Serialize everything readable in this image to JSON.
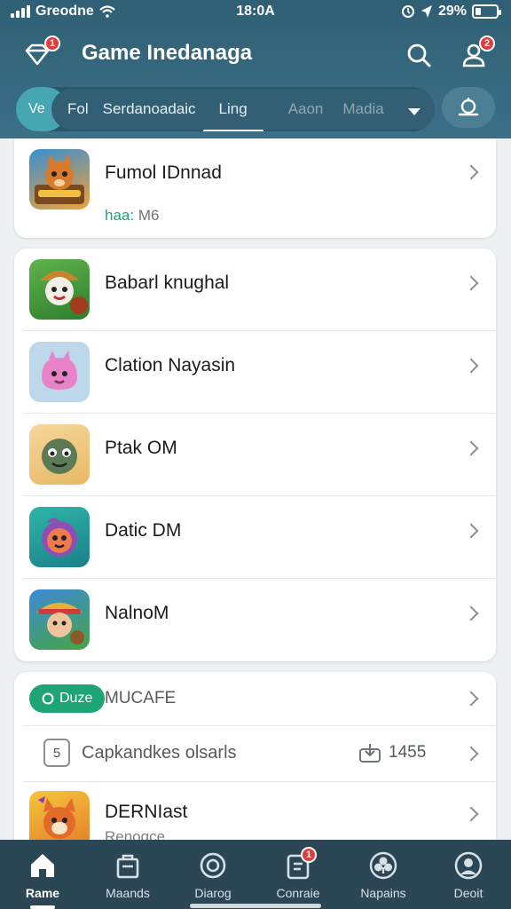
{
  "status_bar": {
    "carrier": "Greodne",
    "time": "18:0A",
    "battery": "29%",
    "battery_level": 0.29
  },
  "header": {
    "title": "Game Inedanaga",
    "menu_badge": "1",
    "profile_badge": "2"
  },
  "tabs": {
    "pill_label": "Ve",
    "items": [
      {
        "label": "Fol",
        "state": "normal"
      },
      {
        "label": "Serdanoadaic",
        "state": "normal"
      },
      {
        "label": "Ling",
        "state": "active"
      },
      {
        "label": "Aaon",
        "state": "muted"
      },
      {
        "label": "Madia",
        "state": "muted"
      }
    ]
  },
  "featured": {
    "name": "Fumol IDnnad",
    "sub_label": "haa:",
    "sub_value": "M6"
  },
  "games": [
    {
      "name": "Babarl knughal"
    },
    {
      "name": "Clation Nayasin"
    },
    {
      "name": "Ptak OM"
    },
    {
      "name": "Datic DM"
    },
    {
      "name": "NalnoM"
    }
  ],
  "section": {
    "pill_label": "Duze",
    "title": "MUCAFE",
    "task_label": "Capkandkes olsarls",
    "task_count": "1455",
    "task_icon_text": "5",
    "last_item_name": "DERNIast",
    "last_item_sub": "Renoqce"
  },
  "bottom_nav": [
    {
      "label": "Rame",
      "active": true
    },
    {
      "label": "Maands",
      "active": false
    },
    {
      "label": "Diarog",
      "active": false,
      "badge": "1"
    },
    {
      "label": "Conraie",
      "active": false
    },
    {
      "label": "Napains",
      "active": false
    },
    {
      "label": "Deoit",
      "active": false
    }
  ],
  "colors": {
    "header": "#2f5f74",
    "accent": "#46a7b3",
    "green": "#1fa573",
    "badge": "#e23b3b",
    "bottom_nav": "#2b4756"
  }
}
